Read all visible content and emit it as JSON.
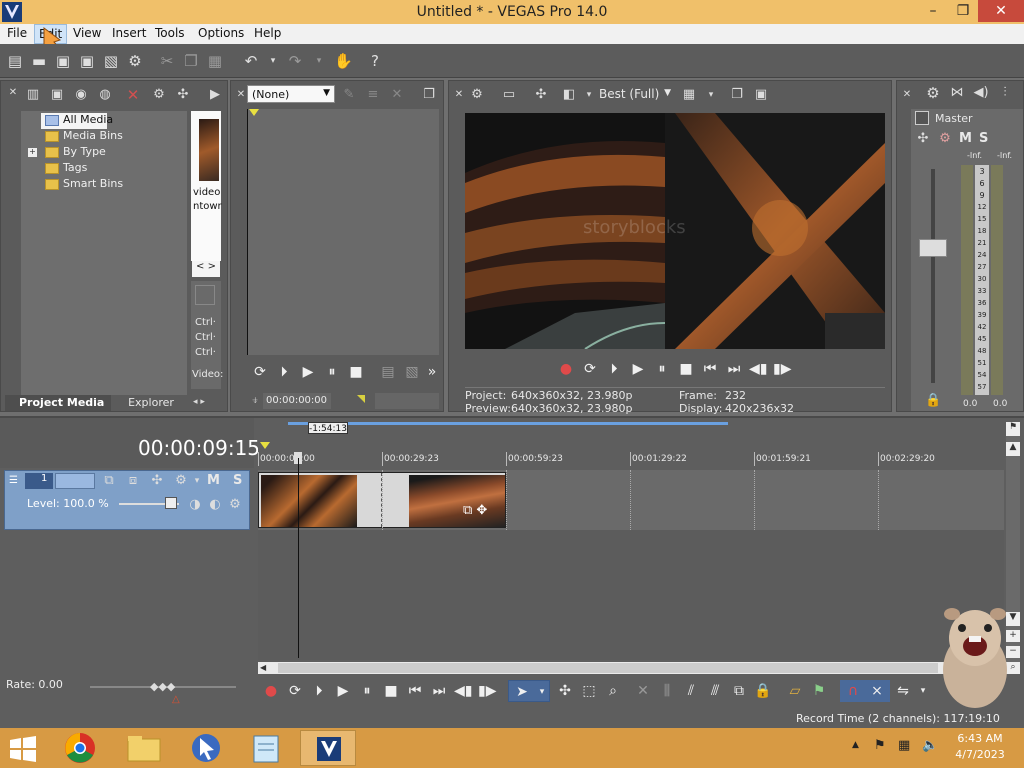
{
  "window": {
    "title": "Untitled * - VEGAS Pro 14.0",
    "minimize": "–",
    "maximize": "❐",
    "close": "✕"
  },
  "menu": [
    "File",
    "Edit",
    "View",
    "Insert",
    "Tools",
    "Options",
    "Help"
  ],
  "project_media": {
    "tree": [
      "All Media",
      "Media Bins",
      "By Type",
      "Tags",
      "Smart Bins"
    ],
    "expand_toggle": "+",
    "thumbnail_caption_1": "video",
    "thumbnail_caption_2": "ntowr",
    "ctrl_lines": [
      "Ctrl·",
      "Ctrl·",
      "Ctrl·"
    ],
    "video_label": "Video:",
    "tabs": [
      "Project Media",
      "Explorer"
    ]
  },
  "trimmer": {
    "preset": "(None)",
    "timecode": "00:00:00:00"
  },
  "preview": {
    "quality": "Best (Full)",
    "watermark": "storyblocks",
    "project_label": "Project:",
    "project_value": "640x360x32, 23.980p",
    "preview_label": "Preview:",
    "preview_value": "640x360x32, 23.980p",
    "frame_label": "Frame:",
    "frame_value": "232",
    "display_label": "Display:",
    "display_value": "420x236x32"
  },
  "mixer": {
    "master_label": "Master",
    "m": "M",
    "s": "S",
    "peak_left": "-Inf.",
    "peak_right": "-Inf.",
    "scale": [
      "3",
      "6",
      "9",
      "12",
      "15",
      "18",
      "21",
      "24",
      "27",
      "30",
      "33",
      "36",
      "39",
      "42",
      "45",
      "48",
      "51",
      "54",
      "57"
    ],
    "level_left": "0.0",
    "level_right": "0.0"
  },
  "timeline": {
    "cursor_time": "00:00:09:15",
    "loop_tag": "-1:54:13",
    "ruler": [
      "00:00:00:00",
      "00:00:29:23",
      "00:00:59:23",
      "00:01:29:22",
      "00:01:59:21",
      "00:02:29:20"
    ],
    "track_number": "1",
    "track_m": "M",
    "track_s": "S",
    "level_label": "Level: 100.0 %",
    "rate_label": "Rate: 0.00",
    "record_time": "Record Time (2 channels): 117:19:10"
  },
  "taskbar": {
    "time": "6:43 AM",
    "date": "4/7/2023"
  }
}
